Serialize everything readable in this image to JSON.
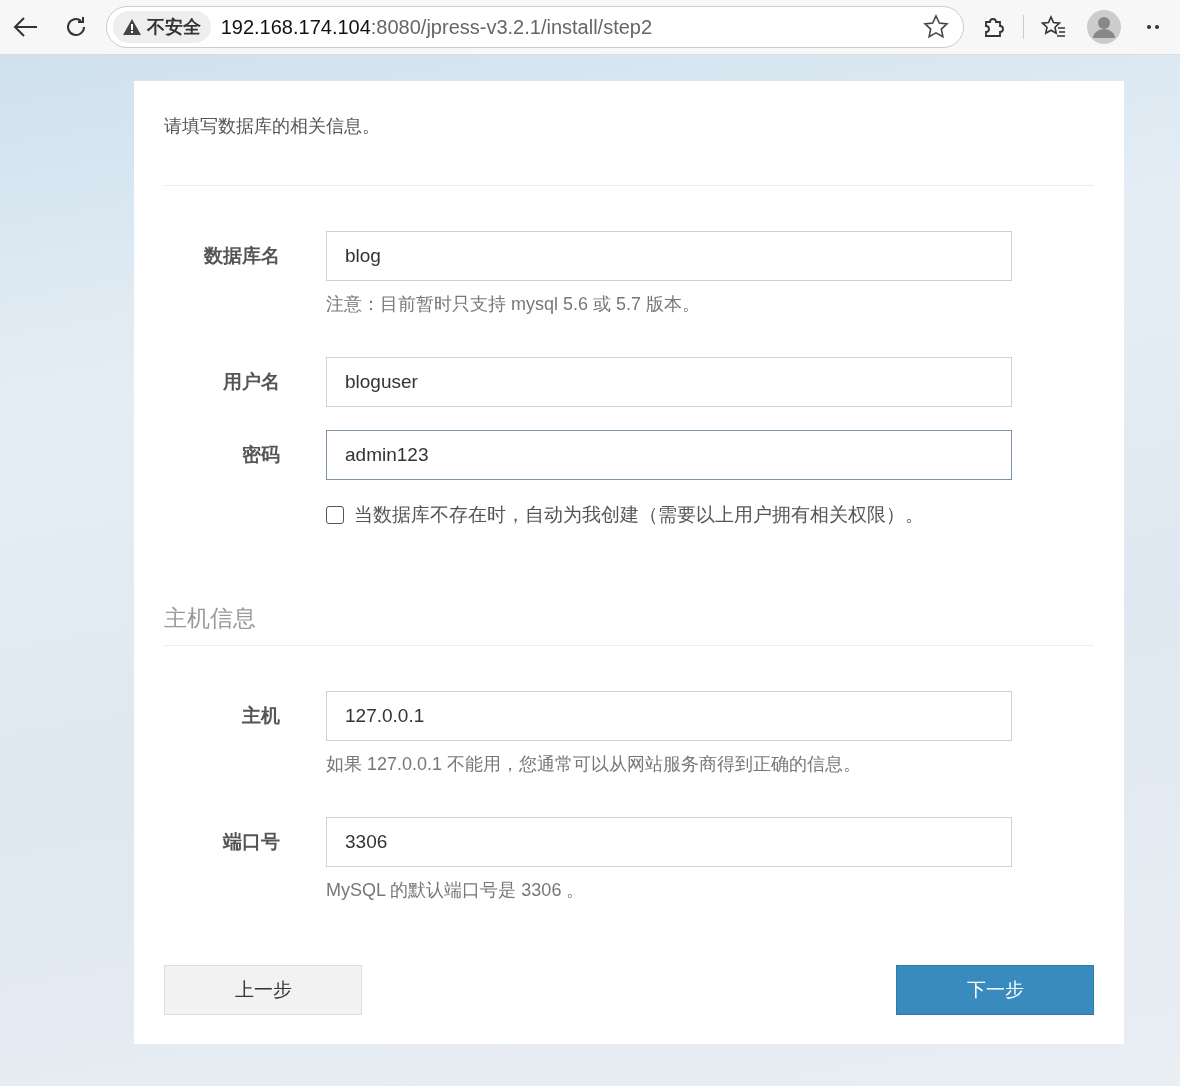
{
  "browser": {
    "security_label": "不安全",
    "url_host": "192.168.174.104",
    "url_rest": ":8080/jpress-v3.2.1/install/step2"
  },
  "intro": "请填写数据库的相关信息。",
  "database_fields": [
    {
      "label": "数据库名",
      "value": "blog",
      "hint": "注意：目前暂时只支持 mysql 5.6 或 5.7 版本。",
      "focused": false
    },
    {
      "label": "用户名",
      "value": "bloguser",
      "focused": false
    },
    {
      "label": "密码",
      "value": "admin123",
      "focused": true
    }
  ],
  "auto_create": {
    "label": "当数据库不存在时，自动为我创建（需要以上用户拥有相关权限）。",
    "checked": false
  },
  "host_section": {
    "title": "主机信息",
    "fields": [
      {
        "label": "主机",
        "value": "127.0.0.1",
        "hint": "如果 127.0.0.1 不能用，您通常可以从网站服务商得到正确的信息。",
        "focused": false
      },
      {
        "label": "端口号",
        "value": "3306",
        "hint": "MySQL 的默认端口号是 3306 。",
        "focused": false
      }
    ]
  },
  "buttons": {
    "back": "上一步",
    "next": "下一步"
  }
}
